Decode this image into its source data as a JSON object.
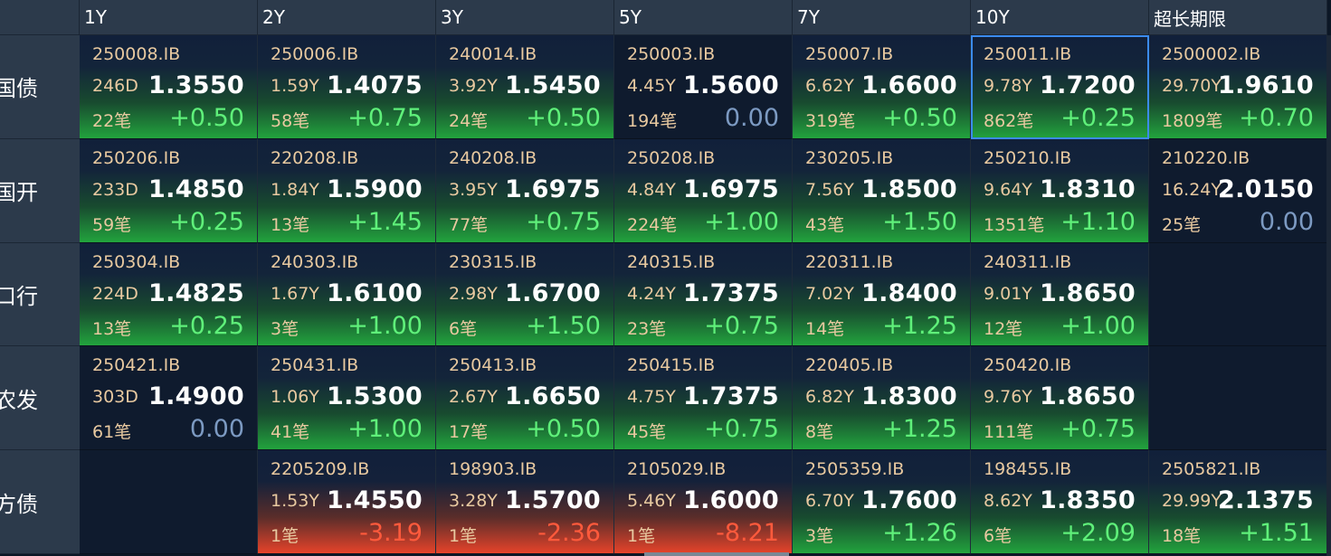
{
  "columns": [
    "1Y",
    "2Y",
    "3Y",
    "5Y",
    "7Y",
    "10Y",
    "超长期限"
  ],
  "rows": [
    {
      "label": "国债",
      "cells": [
        {
          "code": "250008.IB",
          "tenor": "246D",
          "price": "1.3550",
          "count": "22笔",
          "change": "+0.50",
          "trend": "up"
        },
        {
          "code": "250006.IB",
          "tenor": "1.59Y",
          "price": "1.4075",
          "count": "58笔",
          "change": "+0.75",
          "trend": "up"
        },
        {
          "code": "240014.IB",
          "tenor": "3.92Y",
          "price": "1.5450",
          "count": "24笔",
          "change": "+0.50",
          "trend": "up"
        },
        {
          "code": "250003.IB",
          "tenor": "4.45Y",
          "price": "1.5600",
          "count": "194笔",
          "change": "0.00",
          "trend": "flat"
        },
        {
          "code": "250007.IB",
          "tenor": "6.62Y",
          "price": "1.6600",
          "count": "319笔",
          "change": "+0.50",
          "trend": "up"
        },
        {
          "code": "250011.IB",
          "tenor": "9.78Y",
          "price": "1.7200",
          "count": "862笔",
          "change": "+0.25",
          "trend": "up",
          "selected": true
        },
        {
          "code": "2500002.IB",
          "tenor": "29.70Y",
          "price": "1.9610",
          "count": "1809笔",
          "change": "+0.70",
          "trend": "up"
        }
      ]
    },
    {
      "label": "国开",
      "cells": [
        {
          "code": "250206.IB",
          "tenor": "233D",
          "price": "1.4850",
          "count": "59笔",
          "change": "+0.25",
          "trend": "up"
        },
        {
          "code": "220208.IB",
          "tenor": "1.84Y",
          "price": "1.5900",
          "count": "13笔",
          "change": "+1.45",
          "trend": "up"
        },
        {
          "code": "240208.IB",
          "tenor": "3.95Y",
          "price": "1.6975",
          "count": "77笔",
          "change": "+0.75",
          "trend": "up"
        },
        {
          "code": "250208.IB",
          "tenor": "4.84Y",
          "price": "1.6975",
          "count": "224笔",
          "change": "+1.00",
          "trend": "up"
        },
        {
          "code": "230205.IB",
          "tenor": "7.56Y",
          "price": "1.8500",
          "count": "43笔",
          "change": "+1.50",
          "trend": "up"
        },
        {
          "code": "250210.IB",
          "tenor": "9.64Y",
          "price": "1.8310",
          "count": "1351笔",
          "change": "+1.10",
          "trend": "up"
        },
        {
          "code": "210220.IB",
          "tenor": "16.24Y",
          "price": "2.0150",
          "count": "25笔",
          "change": "0.00",
          "trend": "flat"
        }
      ]
    },
    {
      "label": "口行",
      "cells": [
        {
          "code": "250304.IB",
          "tenor": "224D",
          "price": "1.4825",
          "count": "13笔",
          "change": "+0.25",
          "trend": "up"
        },
        {
          "code": "240303.IB",
          "tenor": "1.67Y",
          "price": "1.6100",
          "count": "3笔",
          "change": "+1.00",
          "trend": "up"
        },
        {
          "code": "230315.IB",
          "tenor": "2.98Y",
          "price": "1.6700",
          "count": "6笔",
          "change": "+1.50",
          "trend": "up"
        },
        {
          "code": "240315.IB",
          "tenor": "4.24Y",
          "price": "1.7375",
          "count": "23笔",
          "change": "+0.75",
          "trend": "up"
        },
        {
          "code": "220311.IB",
          "tenor": "7.02Y",
          "price": "1.8400",
          "count": "14笔",
          "change": "+1.25",
          "trend": "up"
        },
        {
          "code": "240311.IB",
          "tenor": "9.01Y",
          "price": "1.8650",
          "count": "12笔",
          "change": "+1.00",
          "trend": "up"
        },
        null
      ]
    },
    {
      "label": "农发",
      "cells": [
        {
          "code": "250421.IB",
          "tenor": "303D",
          "price": "1.4900",
          "count": "61笔",
          "change": "0.00",
          "trend": "flat"
        },
        {
          "code": "250431.IB",
          "tenor": "1.06Y",
          "price": "1.5300",
          "count": "41笔",
          "change": "+1.00",
          "trend": "up"
        },
        {
          "code": "250413.IB",
          "tenor": "2.67Y",
          "price": "1.6650",
          "count": "17笔",
          "change": "+0.50",
          "trend": "up"
        },
        {
          "code": "250415.IB",
          "tenor": "4.75Y",
          "price": "1.7375",
          "count": "45笔",
          "change": "+0.75",
          "trend": "up"
        },
        {
          "code": "220405.IB",
          "tenor": "6.82Y",
          "price": "1.8300",
          "count": "8笔",
          "change": "+1.25",
          "trend": "up"
        },
        {
          "code": "250420.IB",
          "tenor": "9.76Y",
          "price": "1.8650",
          "count": "111笔",
          "change": "+0.75",
          "trend": "up"
        },
        null
      ]
    },
    {
      "label": "地方债",
      "cells": [
        null,
        {
          "code": "2205209.IB",
          "tenor": "1.53Y",
          "price": "1.4550",
          "count": "1笔",
          "change": "-3.19",
          "trend": "down"
        },
        {
          "code": "198903.IB",
          "tenor": "3.28Y",
          "price": "1.5700",
          "count": "1笔",
          "change": "-2.36",
          "trend": "down"
        },
        {
          "code": "2105029.IB",
          "tenor": "5.46Y",
          "price": "1.6000",
          "count": "1笔",
          "change": "-8.21",
          "trend": "down"
        },
        {
          "code": "2505359.IB",
          "tenor": "6.70Y",
          "price": "1.7600",
          "count": "3笔",
          "change": "+1.26",
          "trend": "up"
        },
        {
          "code": "198455.IB",
          "tenor": "8.62Y",
          "price": "1.8350",
          "count": "6笔",
          "change": "+2.09",
          "trend": "up"
        },
        {
          "code": "2505821.IB",
          "tenor": "29.99Y",
          "price": "2.1375",
          "count": "18笔",
          "change": "+1.51",
          "trend": "up"
        }
      ]
    }
  ],
  "colors": {
    "up": "#5ff07a",
    "down": "#ff5a3c",
    "flat": "#7c9ac2",
    "selected_border": "#3b8bf0",
    "header_bg": "#2c3a4b"
  }
}
